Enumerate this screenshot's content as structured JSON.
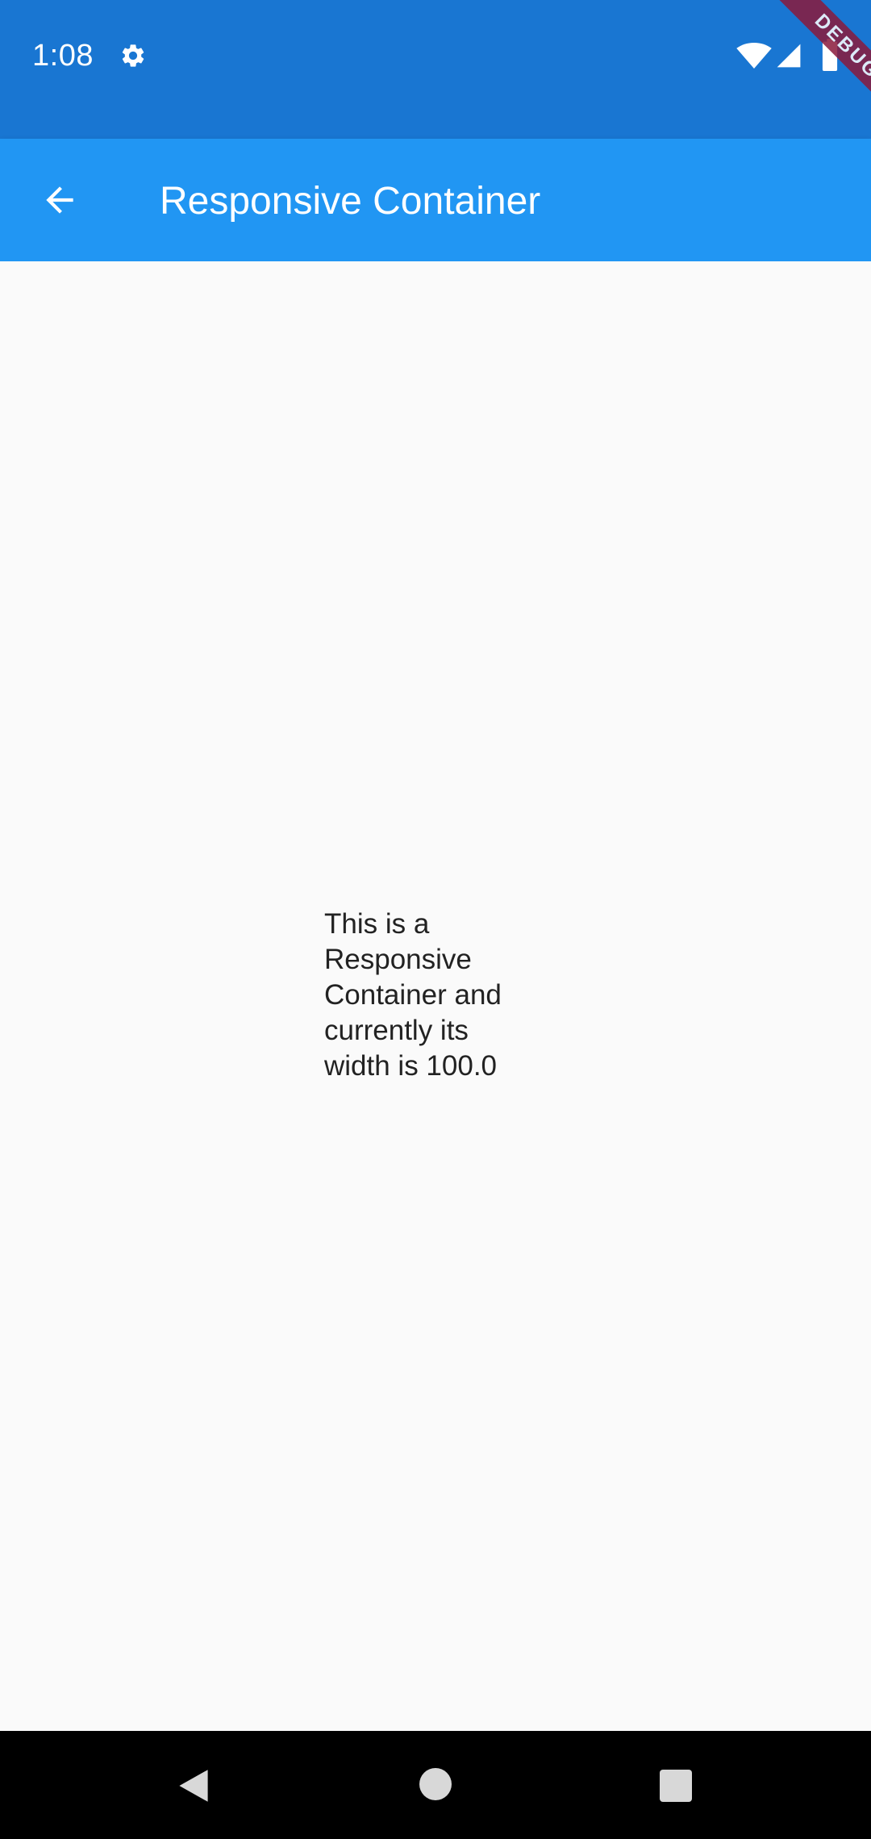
{
  "status_bar": {
    "time": "1:08",
    "icons": [
      "gear-icon",
      "wifi-icon",
      "signal-icon",
      "battery-icon"
    ],
    "color": "#1976d2"
  },
  "debug_banner": {
    "label": "DEBUG"
  },
  "app_bar": {
    "title": "Responsive Container",
    "back_icon": "arrow-back-icon",
    "color": "#2196f3"
  },
  "main": {
    "text": "This is a Responsive Container and currently its width is 100.0"
  },
  "nav_bar": {
    "buttons": [
      "back-triangle-icon",
      "home-circle-icon",
      "recents-square-icon"
    ]
  }
}
